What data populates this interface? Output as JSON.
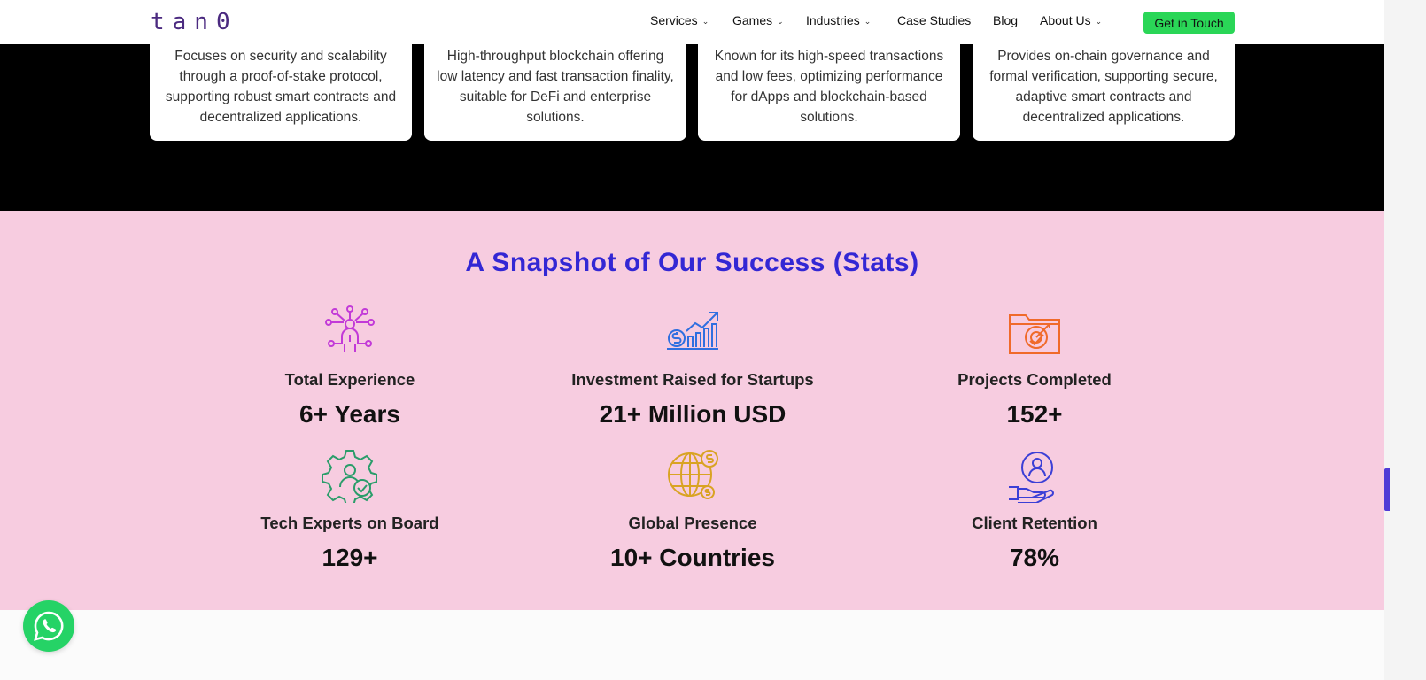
{
  "brand": {
    "logo_text": "tan0"
  },
  "nav": {
    "items": [
      {
        "label": "Services",
        "has_dropdown": true
      },
      {
        "label": "Games",
        "has_dropdown": true
      },
      {
        "label": "Industries",
        "has_dropdown": true
      },
      {
        "label": "Case Studies",
        "has_dropdown": false
      },
      {
        "label": "Blog",
        "has_dropdown": false
      },
      {
        "label": "About Us",
        "has_dropdown": true
      }
    ],
    "cta_label": "Get in Touch",
    "cta_color": "#2ad657"
  },
  "cards": [
    {
      "text": "Focuses on security and scalability through a proof-of-stake protocol, supporting robust smart contracts and decentralized applications."
    },
    {
      "text": "High-throughput blockchain offering low latency and fast transaction finality, suitable for DeFi and enterprise solutions."
    },
    {
      "text": "Known for its high-speed transactions and low fees, optimizing performance for dApps and blockchain-based solutions."
    },
    {
      "text": "Provides on-chain governance and formal verification, supporting secure, adaptive smart contracts and decentralized applications."
    }
  ],
  "stats": {
    "title": "A Snapshot of Our Success (Stats)",
    "accent": "#3327d4",
    "background": "#f7cce0",
    "items": [
      {
        "label": "Total Experience",
        "value": "6+ Years",
        "icon": "network-person-icon",
        "icon_color": "#c23ad8"
      },
      {
        "label": "Investment Raised for Startups",
        "value": "21+ Million USD",
        "icon": "growth-chart-icon",
        "icon_color": "#2f6fe0"
      },
      {
        "label": "Projects Completed",
        "value": "152+",
        "icon": "target-folder-icon",
        "icon_color": "#f06a2a"
      },
      {
        "label": "Tech Experts on Board",
        "value": "129+",
        "icon": "gear-expert-icon",
        "icon_color": "#2a9d6a"
      },
      {
        "label": "Global Presence",
        "value": "10+ Countries",
        "icon": "globe-dollar-icon",
        "icon_color": "#d9a323"
      },
      {
        "label": "Client Retention",
        "value": "78%",
        "icon": "hand-person-icon",
        "icon_color": "#3b3fd6"
      }
    ]
  },
  "whatsapp": {
    "icon": "whatsapp-icon",
    "color": "#25d366"
  }
}
